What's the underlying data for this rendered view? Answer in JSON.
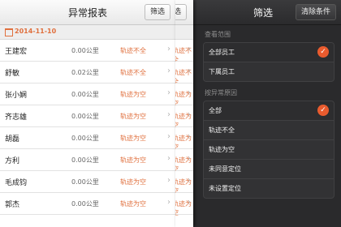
{
  "report": {
    "title": "异常报表",
    "filter_button": "筛选",
    "date": "2014-11-10",
    "rows": [
      {
        "name": "王建宏",
        "distance": "0.00公里",
        "status": "轨迹不全"
      },
      {
        "name": "舒敏",
        "distance": "0.02公里",
        "status": "轨迹不全"
      },
      {
        "name": "张小娴",
        "distance": "0.00公里",
        "status": "轨迹为空"
      },
      {
        "name": "齐志雄",
        "distance": "0.00公里",
        "status": "轨迹为空"
      },
      {
        "name": "胡磊",
        "distance": "0.00公里",
        "status": "轨迹为空"
      },
      {
        "name": "方利",
        "distance": "0.00公里",
        "status": "轨迹为空"
      },
      {
        "name": "毛成钧",
        "distance": "0.00公里",
        "status": "轨迹为空"
      },
      {
        "name": "郭杰",
        "distance": "0.00公里",
        "status": "轨迹为空"
      }
    ]
  },
  "strip": {
    "filter_button": "筛选",
    "statuses": [
      "轨迹不全",
      "轨迹不全",
      "轨迹为空",
      "轨迹为空",
      "轨迹为空",
      "轨迹为空",
      "轨迹为空",
      "轨迹为空"
    ]
  },
  "filter": {
    "title": "筛选",
    "clear_button": "清除条件",
    "scope_label": "查看范围",
    "scope_options": [
      {
        "label": "全部员工",
        "selected": true
      },
      {
        "label": "下属员工",
        "selected": false
      }
    ],
    "reason_label": "按异常原因",
    "reason_options": [
      {
        "label": "全部",
        "selected": true
      },
      {
        "label": "轨迹不全",
        "selected": false
      },
      {
        "label": "轨迹为空",
        "selected": false
      },
      {
        "label": "未同意定位",
        "selected": false
      },
      {
        "label": "未设置定位",
        "selected": false
      }
    ]
  },
  "colors": {
    "accent": "#e95b2e",
    "status_text": "#e0703e",
    "panel_bg": "#2a2a2c"
  },
  "icons": {
    "calendar": "calendar-icon",
    "chevron": "chevron-right-icon",
    "check": "checkmark-icon"
  }
}
